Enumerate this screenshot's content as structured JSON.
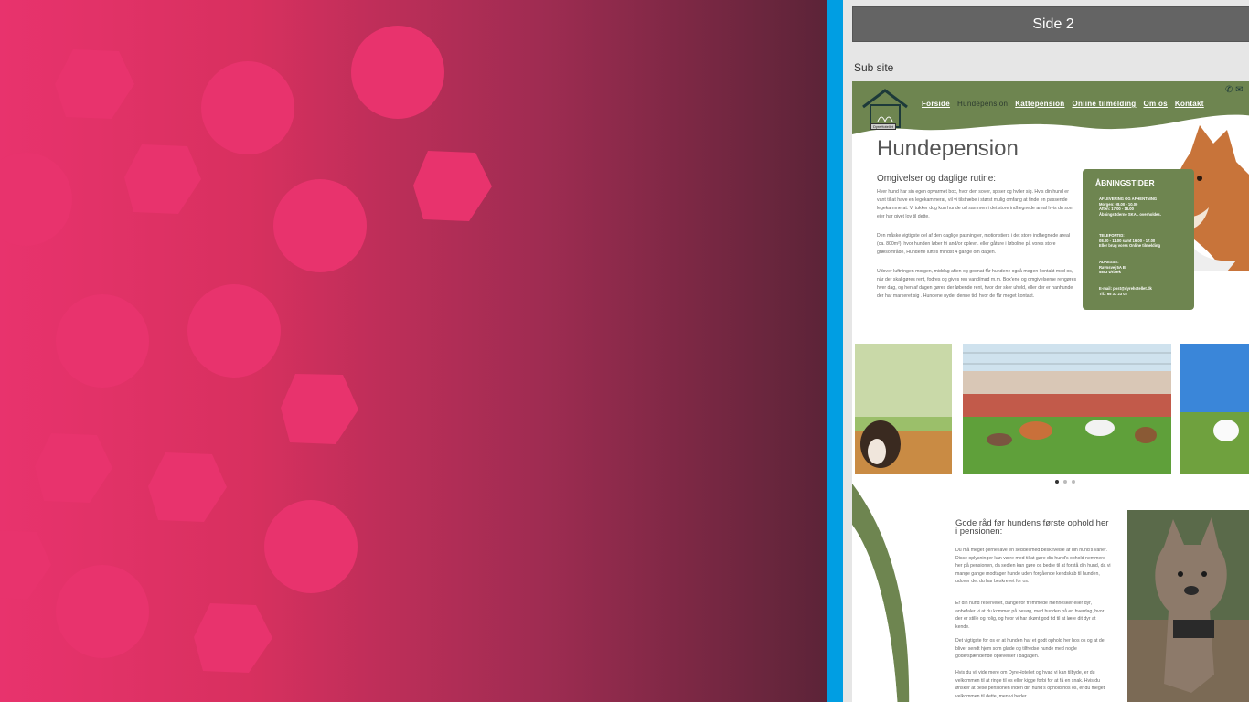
{
  "panel": {
    "title": "Side 2",
    "sub_label": "Sub site"
  },
  "colors": {
    "accent": "#009ee3",
    "pink": "#e8336d",
    "site_green": "#6e8550",
    "header_bar": "#646464"
  },
  "site": {
    "logo_label": "DyreHotellet",
    "nav": [
      "Forside",
      "Hundepension",
      "Kattepension",
      "Online tilmelding",
      "Om os",
      "Kontakt"
    ],
    "active_nav": "Hundepension",
    "contact_icons": [
      "phone-icon",
      "mail-icon"
    ],
    "page_title": "Hundepension",
    "section_heading": "Omgivelser og daglige rutine:",
    "paragraphs": [
      "Hver hund har sin egen opvarmet box, hvor den sover, spiser og hviler sig. Hvis din hund er vant til at have en legekammerat, vil vi tilstræbe i størst mulig omfang at finde en passende legekammerat. Vi tukker dog kun hunde ud sammen i det store indhegnede areal hvis du som ejer har givet lov til dette.",
      "Den måske vigtigste del af den daglige pasning er, motionstiers i det store indhegnede areal (ca. 800m²), hvor hunden løber fri and/or oplevn. eller gåture i løboline på vores store græsområde, Hundene luftes mindst 4 gange om dagen.",
      "Udover luftningen morgen, middag aften og godnat får hundene også megen kontakt med os, når der skal gøres rent, fodres og gives ren vand/mad m.m. Box'ene og omgivelserne rengøres hver dag, og hen af dagen gøres der løbende rent, hvor der sker uheld, eller der er hanhunde der har markeret sig . Hundene nyder denne tid, hvor de får meget kontakt."
    ],
    "hours": {
      "title": "ÅBNINGSTIDER",
      "blocks": [
        "AFLEVERING OG AFHENTNING\nMorgen: 08.00 - 10.00\nAften: 17.00 - 18.00\nÅbningstiderne SKAL overholdes.",
        "TELEFONTID:\n08.00 - 11.00 samt 16.00 - 17.00\nEller brug vores Online tilmelding",
        "ADRESSE:\nRavnsvej 5A B\n5853 Ørbæk",
        "E-mail: post@dyrehotellet.dk\nTlf.: 65 33 23 02"
      ]
    },
    "gallery": {
      "images": [
        "dog-in-field",
        "dogs-playing-in-yard",
        "dog-on-grass"
      ],
      "active_dot": 0,
      "dot_count": 3
    },
    "advice_heading": "Gode råd før hundens første ophold her i pensionen:",
    "advice_paragraphs": [
      "Du må meget gerne lave en seddel med beskrivelse af din hund's vaner. Disse oplysninger kan være med til at gøre din hund's ophold nemmere her på pensionen, da sedlen kan gøre os bedre til at forstå din hund, da vi mange gange modtager hunde uden forgående kendskab til hunden, udover det du har beskrevet for os.",
      "Er din hund reserveret, bange for fremmede mennesker eller dyr, anbefaler vi at du kommer på besøg, med hunden på en hverdag, hvor der er stille og rolig, og hvor vi har skønt god tid til at lære dit dyr at kende.",
      "Det vigtigste for os er at hunden har et godt ophold her hos os og at de bliver sendt hjem som glade og tilfredse hunde med nogle gode/spændende oplevelser i bagagen.",
      "Hvis du vil vide mere om DyreHotellet og hvad vi kan tilbyde, er du velkommen til at ringe til os eller kigge forbi for at få en snak. Hvis du ønsker at bese pensionen inden din hund's ophold hos os, er du meget velkommen til dette, men vi beder"
    ]
  }
}
